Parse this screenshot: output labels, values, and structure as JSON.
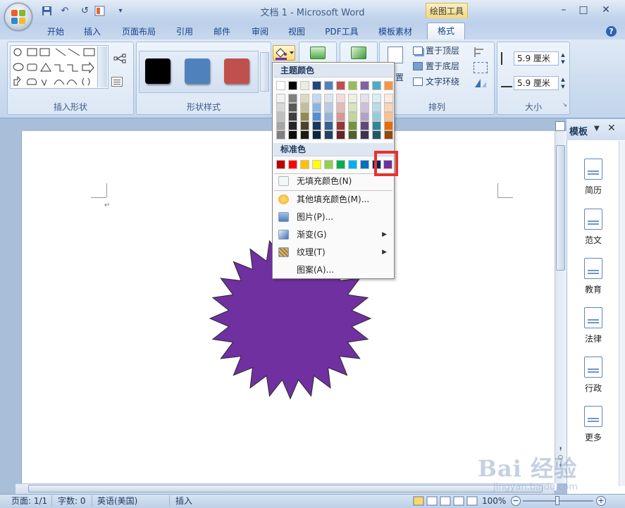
{
  "window": {
    "title": "文档 1 - Microsoft Word",
    "contextual_tab_group": "绘图工具",
    "controls": {
      "minimize": "–",
      "maximize": "□",
      "close": "✕"
    }
  },
  "quick_access": {
    "save": "save-icon",
    "undo": "↶",
    "redo": "↺",
    "customize": "▾"
  },
  "tabs": [
    {
      "label": "开始"
    },
    {
      "label": "插入"
    },
    {
      "label": "页面布局"
    },
    {
      "label": "引用"
    },
    {
      "label": "邮件"
    },
    {
      "label": "审阅"
    },
    {
      "label": "视图"
    },
    {
      "label": "PDF工具"
    },
    {
      "label": "模板素材"
    },
    {
      "label": "格式",
      "active": true
    }
  ],
  "ribbon": {
    "insert_shapes_label": "插入形状",
    "shape_styles_label": "形状样式",
    "arrange_label": "排列",
    "size_label": "大小",
    "style_swatches": [
      "#000000",
      "#4f81bd",
      "#c0504d"
    ],
    "arrange": {
      "bring_front": "置于顶层",
      "send_back": "置于底层",
      "text_wrap": "文字环绕",
      "position_partial": "置"
    },
    "size": {
      "height": "5.9 厘米",
      "width": "5.9 厘米"
    }
  },
  "fill_dropdown": {
    "theme_colors_label": "主题颜色",
    "standard_colors_label": "标准色",
    "theme_top_row": [
      "#ffffff",
      "#000000",
      "#eeece1",
      "#1f497d",
      "#4f81bd",
      "#c0504d",
      "#9bbb59",
      "#8064a2",
      "#4bacc6",
      "#f79646"
    ],
    "theme_shades": [
      [
        "#f2f2f2",
        "#7f7f7f",
        "#ddd9c3",
        "#c6d9f0",
        "#dbe5f1",
        "#f2dcdb",
        "#ebf1dd",
        "#e5e0ec",
        "#dbeef3",
        "#fdeada"
      ],
      [
        "#d8d8d8",
        "#595959",
        "#c4bd97",
        "#8db3e2",
        "#b8cce4",
        "#e5b9b7",
        "#d7e3bc",
        "#ccc1d9",
        "#b7dde8",
        "#fbd5b5"
      ],
      [
        "#bfbfbf",
        "#3f3f3f",
        "#938953",
        "#548dd4",
        "#95b3d7",
        "#d99694",
        "#c3d69b",
        "#b2a2c7",
        "#92cddc",
        "#fac08f"
      ],
      [
        "#a5a5a5",
        "#262626",
        "#494429",
        "#17365d",
        "#366092",
        "#953734",
        "#76923c",
        "#5f497a",
        "#31859b",
        "#e36c09"
      ],
      [
        "#7f7f7f",
        "#0c0c0c",
        "#1d1b10",
        "#0f243e",
        "#244061",
        "#632423",
        "#4f6128",
        "#3f3151",
        "#205867",
        "#974806"
      ]
    ],
    "standard_colors": [
      "#c00000",
      "#ff0000",
      "#ffc000",
      "#ffff00",
      "#92d050",
      "#00b050",
      "#00b0f0",
      "#0070c0",
      "#002060",
      "#7030a0"
    ],
    "items": [
      {
        "label": "无填充颜色(N)",
        "icon": "no-fill-icon"
      },
      {
        "label": "其他填充颜色(M)...",
        "icon": "palette-icon"
      },
      {
        "label": "图片(P)...",
        "icon": "picture-icon"
      },
      {
        "label": "渐变(G)",
        "icon": "gradient-icon",
        "submenu": true
      },
      {
        "label": "纹理(T)",
        "icon": "texture-icon",
        "submenu": true
      },
      {
        "label": "图案(A)...",
        "icon": "pattern-icon"
      }
    ],
    "highlighted_color": "#7030a0"
  },
  "document": {
    "shape": "24-point star",
    "shape_fill": "#7030a0",
    "paragraph_mark": "↵"
  },
  "side_pane": {
    "title": "模板",
    "items": [
      {
        "label": "简历",
        "icon": "resume-icon"
      },
      {
        "label": "范文",
        "icon": "sample-icon"
      },
      {
        "label": "教育",
        "icon": "education-icon"
      },
      {
        "label": "法律",
        "icon": "law-icon"
      },
      {
        "label": "行政",
        "icon": "admin-icon"
      },
      {
        "label": "更多",
        "icon": "more-icon"
      }
    ]
  },
  "status": {
    "page": "页面: 1/1",
    "words": "字数: 0",
    "language": "英语(美国)",
    "mode": "插入",
    "zoom": "100%"
  },
  "watermark": {
    "brand": "Bai 经验",
    "url": "jingyan.baidu.com"
  }
}
